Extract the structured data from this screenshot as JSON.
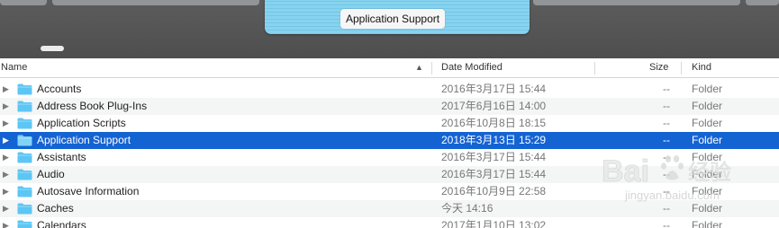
{
  "coverflow": {
    "selected_title": "Application Support"
  },
  "columns": {
    "name": "Name",
    "date_modified": "Date Modified",
    "size": "Size",
    "kind": "Kind"
  },
  "rows": [
    {
      "name": "Accounts",
      "date": "2016年3月17日 15:44",
      "size": "--",
      "kind": "Folder",
      "selected": false
    },
    {
      "name": "Address Book Plug-Ins",
      "date": "2017年6月16日 14:00",
      "size": "--",
      "kind": "Folder",
      "selected": false
    },
    {
      "name": "Application Scripts",
      "date": "2016年10月8日 18:15",
      "size": "--",
      "kind": "Folder",
      "selected": false
    },
    {
      "name": "Application Support",
      "date": "2018年3月13日 15:29",
      "size": "--",
      "kind": "Folder",
      "selected": true
    },
    {
      "name": "Assistants",
      "date": "2016年3月17日 15:44",
      "size": "--",
      "kind": "Folder",
      "selected": false
    },
    {
      "name": "Audio",
      "date": "2016年3月17日 15:44",
      "size": "--",
      "kind": "Folder",
      "selected": false
    },
    {
      "name": "Autosave Information",
      "date": "2016年10月9日 22:58",
      "size": "--",
      "kind": "Folder",
      "selected": false
    },
    {
      "name": "Caches",
      "date": "今天 14:16",
      "size": "--",
      "kind": "Folder",
      "selected": false
    },
    {
      "name": "Calendars",
      "date": "2017年1月10日 13:02",
      "size": "--",
      "kind": "Folder",
      "selected": false
    }
  ],
  "watermark": {
    "brand": "Bai",
    "brand_cn": "经验",
    "url": "jingyan.baidu.com"
  },
  "colors": {
    "selection": "#1463d3",
    "folder": "#5cc6f4",
    "coverflow_bg": "#555555"
  }
}
